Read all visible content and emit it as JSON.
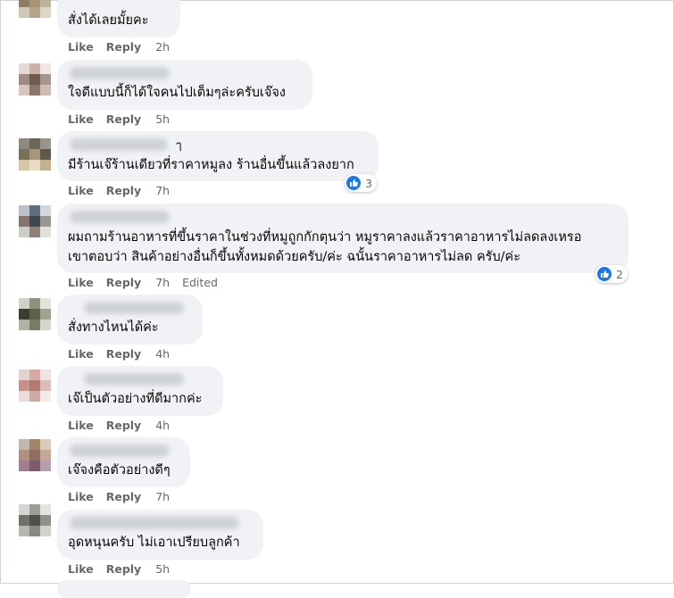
{
  "labels": {
    "like": "Like",
    "reply": "Reply",
    "edited": "Edited"
  },
  "comments": [
    {
      "text": [
        "สั่งได้เลยมั้ยคะ"
      ],
      "time": "2h"
    },
    {
      "text": [
        "ใจดีแบบนี้ก็ได้ใจคนไปเต็มๆล่ะครับเจ๊จง"
      ],
      "time": "5h"
    },
    {
      "name_trail": "ๅ",
      "text": [
        "มีร้านเจ๊ร้านเดียวที่ราคาหมูลง ร้านอื่นขึ้นแล้วลงยาก"
      ],
      "time": "7h",
      "reactions": "3"
    },
    {
      "text": [
        "ผมถามร้านอาหารที่ขึ้นราคาในช่วงที่หมูถูกกักตุนว่า หมูราคาลงแล้วราคาอาหารไม่ลดลงเหรอ",
        "เขาตอบว่า สินค้าอย่างอื่นก็ขึ้นทั้งหมดด้วยครับ/ค่ะ ฉนั้นราคาอาหารไม่ลด ครับ/ค่ะ"
      ],
      "time": "7h",
      "edited": true,
      "reactions": "2"
    },
    {
      "text": [
        "สั่งทางไหนได้ค่ะ"
      ],
      "time": "4h"
    },
    {
      "text": [
        "เจ๊เป็นตัวอย่างที่ดีมากค่ะ"
      ],
      "time": "4h"
    },
    {
      "text": [
        "เจ๊จงคือตัวอย่างดีๆ"
      ],
      "time": "7h"
    },
    {
      "text": [
        "อุดหนุนครับ ไม่เอาเปรียบลูกค้า"
      ],
      "time": "5h"
    }
  ]
}
